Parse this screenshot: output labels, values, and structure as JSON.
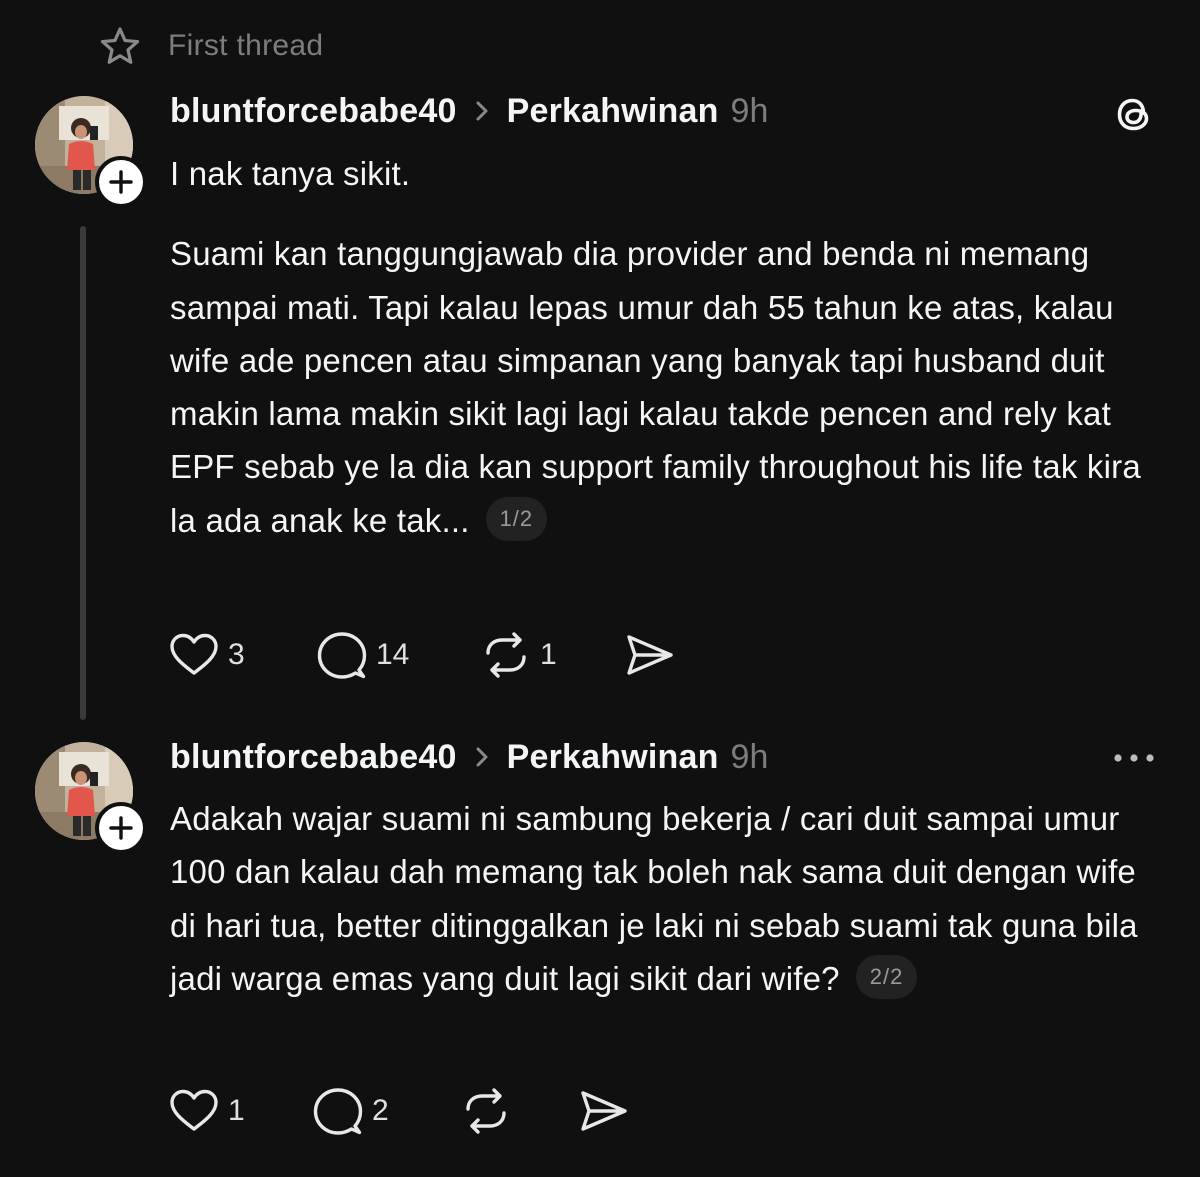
{
  "thread_header": {
    "title": "First thread",
    "icon": "star-outline-icon"
  },
  "colors": {
    "background": "#101010",
    "text_primary": "#f3f5f7",
    "text_secondary": "#7d7d7d",
    "thread_line": "#3a3a3a",
    "pill_bg": "#222222"
  },
  "posts": [
    {
      "username": "bluntforcebabe40",
      "community": "Perkahwinan",
      "time": "9h",
      "corner_icon": "threads-logo-icon",
      "paragraphs": [
        "I nak tanya sikit.",
        "Suami kan tanggungjawab dia provider and benda ni memang sampai mati. Tapi kalau lepas umur dah 55 tahun ke atas, kalau wife ade pencen atau simpanan yang banyak tapi husband duit makin lama makin sikit lagi lagi kalau takde pencen and rely kat EPF sebab ye la dia kan support family throughout his life tak kira la ada anak ke tak..."
      ],
      "page_indicator": "1/2",
      "likes": "3",
      "replies": "14",
      "reposts": "1"
    },
    {
      "username": "bluntforcebabe40",
      "community": "Perkahwinan",
      "time": "9h",
      "corner_icon": "more-horizontal-icon",
      "paragraphs": [
        "Adakah wajar suami ni sambung bekerja / cari duit sampai umur 100 dan kalau dah memang tak boleh nak sama duit dengan wife di hari tua, better ditinggalkan je laki ni sebab suami tak guna bila jadi warga emas yang duit lagi sikit dari wife?"
      ],
      "page_indicator": "2/2",
      "likes": "1",
      "replies": "2",
      "reposts": ""
    }
  ]
}
